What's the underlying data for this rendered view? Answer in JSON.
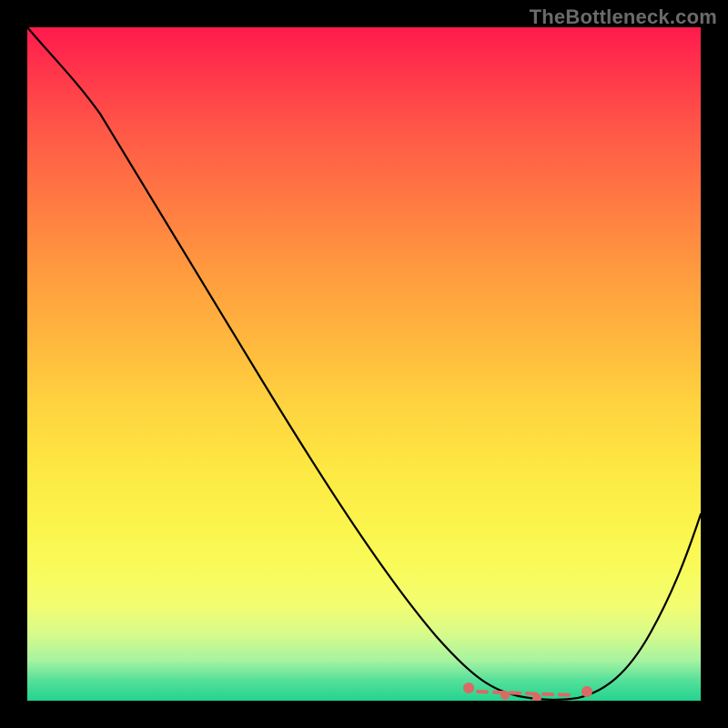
{
  "watermark": "TheBottleneck.com",
  "chart_data": {
    "type": "line",
    "title": "",
    "xlabel": "",
    "ylabel": "",
    "xlim": [
      0,
      100
    ],
    "ylim": [
      0,
      100
    ],
    "grid": false,
    "legend": false,
    "gradient_background": {
      "direction": "top-to-bottom",
      "stops": [
        {
          "pos": 0,
          "color": "#ff1a4d"
        },
        {
          "pos": 50,
          "color": "#ffd33f"
        },
        {
          "pos": 85,
          "color": "#f5fd6a"
        },
        {
          "pos": 100,
          "color": "#22d48f"
        }
      ]
    },
    "series": [
      {
        "name": "bottleneck-curve",
        "color": "#000000",
        "x": [
          0,
          4,
          8,
          12,
          16,
          20,
          24,
          28,
          32,
          36,
          40,
          44,
          48,
          52,
          56,
          60,
          64,
          68,
          72,
          76,
          80,
          84,
          88,
          92,
          96,
          100
        ],
        "values": [
          100,
          96,
          91,
          85,
          80,
          74,
          68,
          62,
          56,
          50,
          44,
          38,
          32,
          26,
          20,
          14,
          9,
          5,
          2,
          0.5,
          0,
          0.5,
          3,
          8,
          16,
          28
        ]
      }
    ],
    "optimal_markers": {
      "description": "highlighted near-zero bottleneck band",
      "color": "#d96a66",
      "x_range": [
        66,
        84
      ],
      "points": [
        {
          "x": 66,
          "y": 3
        },
        {
          "x": 70,
          "y": 1.2
        },
        {
          "x": 74,
          "y": 0.5
        },
        {
          "x": 78,
          "y": 0.3
        },
        {
          "x": 82,
          "y": 0.8
        },
        {
          "x": 84,
          "y": 2
        }
      ]
    }
  }
}
